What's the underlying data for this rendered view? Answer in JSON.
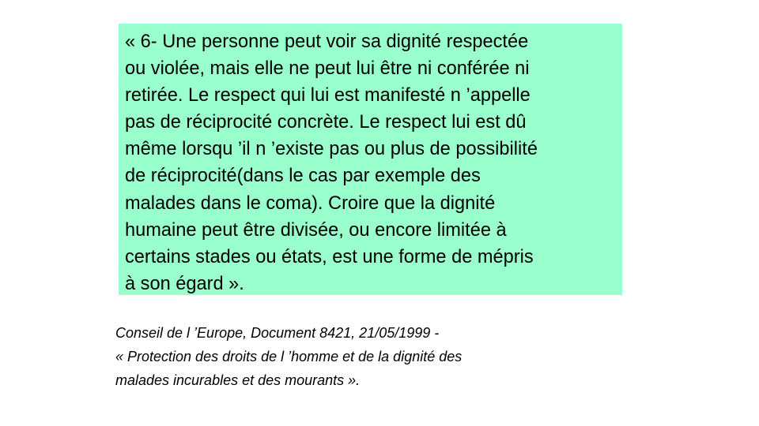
{
  "quote": {
    "lines": [
      "« 6- Une personne peut voir sa dignité respectée",
      "ou violée, mais elle ne peut lui être ni conférée ni",
      "retirée. Le respect qui lui est manifesté n ’appelle",
      "pas de réciprocité concrète. Le respect lui est dû",
      "même lorsqu ’il n ’existe pas ou plus de possibilité",
      "de réciprocité(dans le cas par exemple des",
      "malades dans le coma). Croire que la dignité",
      "humaine peut être divisée, ou encore limitée à",
      "certains stades ou états, est une forme de mépris",
      "à son égard »."
    ]
  },
  "citation": {
    "lines": [
      "Conseil de l ’Europe, Document  8421, 21/05/1999 -",
      "« Protection des droits de l ’homme et de la dignité des",
      "malades incurables et des mourants »."
    ]
  },
  "colors": {
    "quote_background": "#99ffcc",
    "page_background": "#ffffff",
    "text": "#000000"
  }
}
